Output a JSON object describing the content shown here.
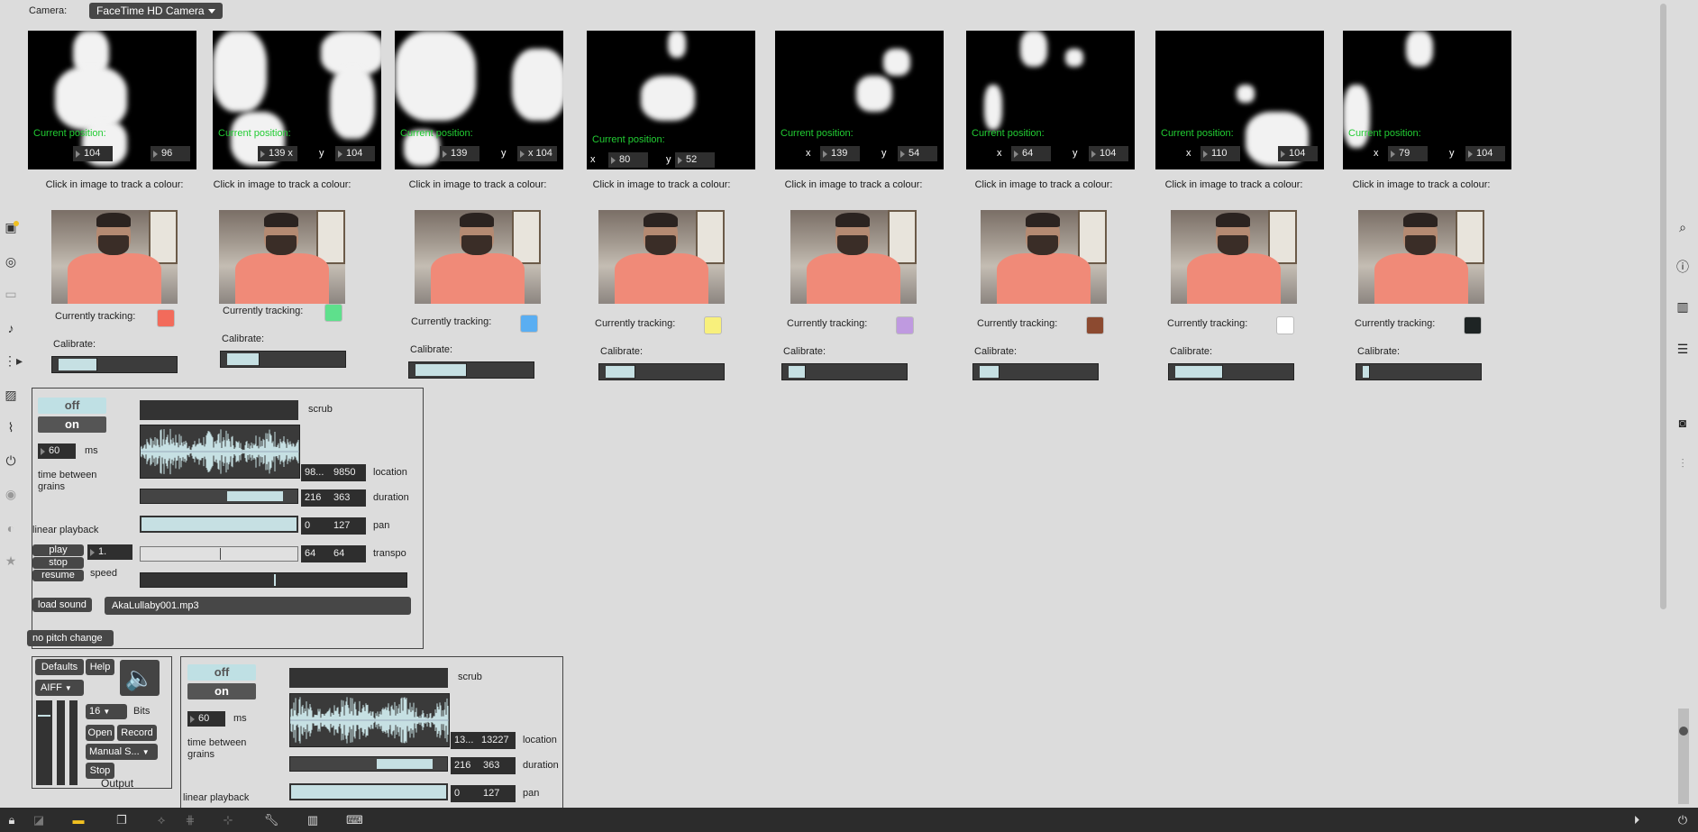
{
  "camera": {
    "label": "Camera:",
    "device": "FaceTime HD Camera"
  },
  "trackers": [
    {
      "pos_label": "Current position:",
      "x_prefix": "",
      "x": "104",
      "y_prefix": "",
      "y": "96",
      "caption": "Click in image to track a colour:",
      "tracking_label": "Currently tracking:",
      "color": "#f26b5b",
      "calibrate_label": "Calibrate:",
      "cal_fill": [
        0.05,
        0.35
      ]
    },
    {
      "pos_label": "Current position:",
      "x_prefix": "",
      "x": "139 x",
      "y_prefix": "y",
      "y": "104",
      "caption": "Click in image to track a colour:",
      "tracking_label": "Currently tracking:",
      "color": "#5ee08c",
      "calibrate_label": "Calibrate:",
      "cal_fill": [
        0.05,
        0.3
      ]
    },
    {
      "pos_label": "Current position:",
      "x_prefix": "",
      "x": "139",
      "y_prefix": "y",
      "y": "x 104",
      "caption": "Click in image to track a colour:",
      "tracking_label": "Currently tracking:",
      "color": "#5aaef2",
      "calibrate_label": "Calibrate:",
      "cal_fill": [
        0.05,
        0.45
      ]
    },
    {
      "pos_label": "Current position:",
      "x_prefix": "x",
      "x": "80",
      "y_prefix": "y",
      "y": "52",
      "caption": "Click in image to track a colour:",
      "tracking_label": "Currently tracking:",
      "color": "#f8f07c",
      "calibrate_label": "Calibrate:",
      "cal_fill": [
        0.05,
        0.28
      ]
    },
    {
      "pos_label": "Current position:",
      "x_prefix": "x",
      "x": "139",
      "y_prefix": "y",
      "y": "54",
      "caption": "Click in image to track a colour:",
      "tracking_label": "Currently tracking:",
      "color": "#bf9ae0",
      "calibrate_label": "Calibrate:",
      "cal_fill": [
        0.05,
        0.18
      ]
    },
    {
      "pos_label": "Current position:",
      "x_prefix": "x",
      "x": "64",
      "y_prefix": "y",
      "y": "104",
      "caption": "Click in image to track a colour:",
      "tracking_label": "Currently tracking:",
      "color": "#8c4a30",
      "calibrate_label": "Calibrate:",
      "cal_fill": [
        0.05,
        0.2
      ]
    },
    {
      "pos_label": "Current position:",
      "x_prefix": "x",
      "x": "110",
      "y_prefix": "",
      "y": "104",
      "caption": "Click in image to track a colour:",
      "tracking_label": "Currently tracking:",
      "color": "#ffffff",
      "calibrate_label": "Calibrate:",
      "cal_fill": [
        0.05,
        0.42
      ]
    },
    {
      "pos_label": "Current position:",
      "x_prefix": "x",
      "x": "79",
      "y_prefix": "y",
      "y": "104",
      "caption": "Click in image to track a colour:",
      "tracking_label": "Currently tracking:",
      "color": "#1e2424",
      "calibrate_label": "Calibrate:",
      "cal_fill": [
        0.05,
        0.1
      ]
    }
  ],
  "granular1": {
    "off": "off",
    "on": "on",
    "ms_value": "60",
    "ms_unit": "ms",
    "time_label": "time between grains",
    "linear": "linear playback",
    "scrub": "scrub",
    "location": {
      "a": "98...",
      "b": "9850",
      "label": "location"
    },
    "duration": {
      "a": "216",
      "b": "363",
      "label": "duration"
    },
    "pan": {
      "a": "0",
      "b": "127",
      "label": "pan"
    },
    "transpo": {
      "a": "64",
      "b": "64",
      "label": "transpo"
    },
    "play": "play",
    "stop": "stop",
    "resume": "resume",
    "speed_value": "1.",
    "speed": "speed",
    "load_sound": "load sound",
    "filename": "AkaLullaby001.mp3",
    "no_pitch": "no pitch change"
  },
  "recorder": {
    "defaults": "Defaults",
    "help": "Help",
    "format": "AIFF",
    "bits_value": "16",
    "bits": "Bits",
    "open": "Open",
    "record": "Record",
    "mode": "Manual S...",
    "stop": "Stop",
    "output": "Output"
  },
  "granular2": {
    "off": "off",
    "on": "on",
    "ms_value": "60",
    "ms_unit": "ms",
    "time_label": "time between grains",
    "linear": "linear playback",
    "scrub": "scrub",
    "location": {
      "a": "13...",
      "b": "13227",
      "label": "location"
    },
    "duration": {
      "a": "216",
      "b": "363",
      "label": "duration"
    },
    "pan": {
      "a": "0",
      "b": "127",
      "label": "pan"
    }
  },
  "left_icons": [
    "package-icon",
    "target-icon",
    "frame-icon",
    "music-note-icon",
    "media-icon",
    "image-icon",
    "paperclip-icon",
    "plug-icon",
    "v8-icon",
    "brush-icon",
    "star-icon"
  ],
  "right_icons": [
    "search-icon",
    "info-icon",
    "book-icon",
    "list-icon",
    "camera-icon",
    "mixer-icon"
  ],
  "bottom_icons": [
    "lock-icon",
    "edit-icon",
    "comment-icon",
    "layers-icon",
    "patch-icon",
    "grid-icon",
    "snap-icon",
    "wrench-icon",
    "piano-icon",
    "keyboard-icon"
  ]
}
